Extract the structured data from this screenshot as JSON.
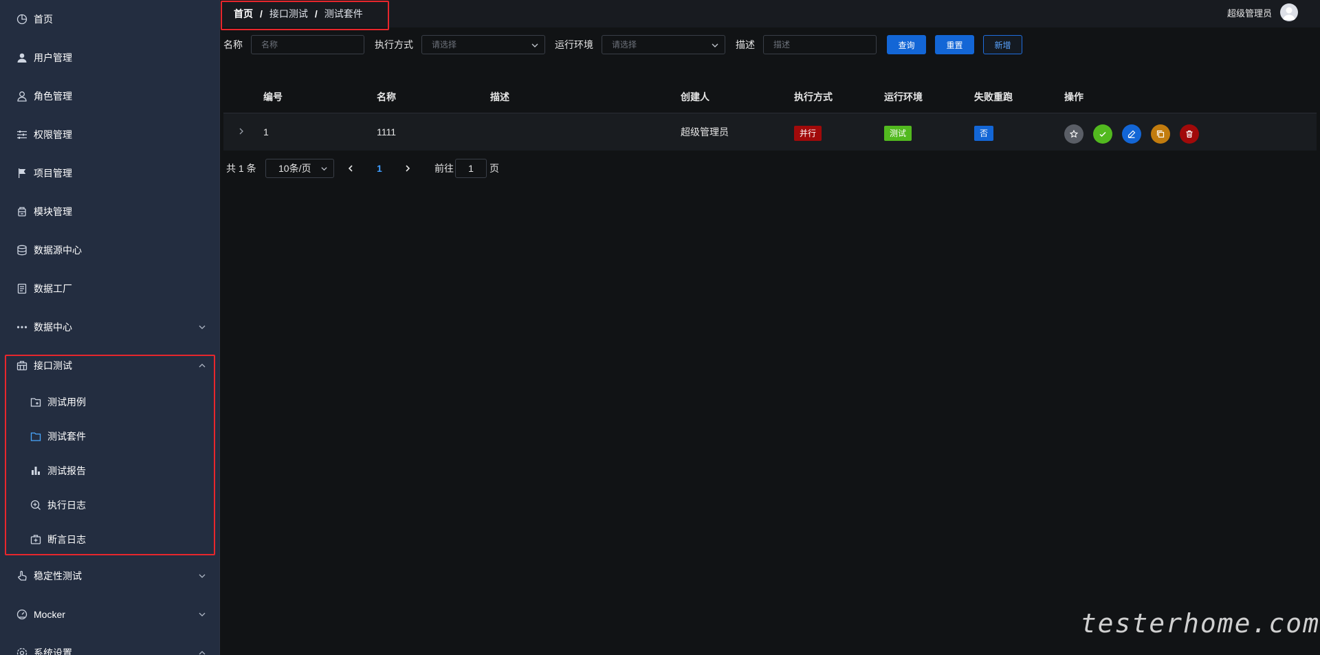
{
  "sidebar": {
    "items": [
      {
        "label": "首页",
        "icon": "pie-chart-icon"
      },
      {
        "label": "用户管理",
        "icon": "user-filled-icon"
      },
      {
        "label": "角色管理",
        "icon": "user-outline-icon"
      },
      {
        "label": "权限管理",
        "icon": "sliders-icon"
      },
      {
        "label": "项目管理",
        "icon": "flag-icon"
      },
      {
        "label": "模块管理",
        "icon": "box-icon"
      },
      {
        "label": "数据源中心",
        "icon": "database-icon"
      },
      {
        "label": "数据工厂",
        "icon": "document-icon"
      },
      {
        "label": "数据中心",
        "icon": "more-dots-icon"
      },
      {
        "label": "接口测试",
        "icon": "briefcase-icon"
      }
    ],
    "submenu": [
      {
        "label": "测试用例",
        "icon": "folder-add-icon"
      },
      {
        "label": "测试套件",
        "icon": "folder-icon"
      },
      {
        "label": "测试报告",
        "icon": "bar-chart-icon"
      },
      {
        "label": "执行日志",
        "icon": "zoom-in-icon"
      },
      {
        "label": "断言日志",
        "icon": "first-aid-kit-icon"
      }
    ],
    "bottom_items": [
      {
        "label": "稳定性测试",
        "icon": "pointer-icon"
      },
      {
        "label": "Mocker",
        "icon": "odometer-icon"
      },
      {
        "label": "系统设置",
        "icon": "setting-icon"
      }
    ]
  },
  "header": {
    "breadcrumb": [
      "首页",
      "接口测试",
      "测试套件"
    ],
    "separator": "/",
    "username": "超级管理员"
  },
  "filters": {
    "name_label": "名称",
    "name_placeholder": "名称",
    "exec_label": "执行方式",
    "exec_placeholder": "请选择",
    "env_label": "运行环境",
    "env_placeholder": "请选择",
    "desc_label": "描述",
    "desc_placeholder": "描述",
    "query_label": "查询",
    "reset_label": "重置",
    "add_label": "新增"
  },
  "table": {
    "columns": [
      "编号",
      "名称",
      "描述",
      "创建人",
      "执行方式",
      "运行环境",
      "失败重跑",
      "操作"
    ],
    "rows": [
      {
        "id": "1",
        "name": "1111",
        "desc": "",
        "creator": "超级管理员",
        "exec_mode": "并行",
        "env": "测试",
        "retry": "否"
      }
    ]
  },
  "pagination": {
    "total": "共 1 条",
    "page_size": "10条/页",
    "current_page": "1",
    "goto_label": "前往",
    "goto_value": "1",
    "page_suffix": "页"
  },
  "colors": {
    "sidebar_bg": "#232d40",
    "main_bg": "#111315",
    "primary": "#1366d6",
    "tag_parallel": "#a10a0a",
    "tag_env": "#52b91f",
    "tag_retry": "#1366d6",
    "highlight_box": "#e8262c"
  },
  "watermark": "testerhome.com"
}
